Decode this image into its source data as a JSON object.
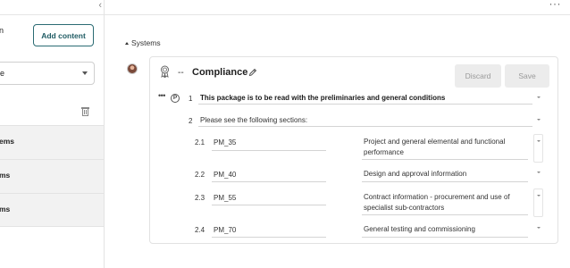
{
  "left_panel": {
    "header_fragment": "n",
    "add_content_label": "Add content",
    "select_value": "e",
    "rows": [
      {
        "label": "ems"
      },
      {
        "label": "ms"
      },
      {
        "label": "ms"
      }
    ]
  },
  "topbar": {
    "collapse_icon": "‹",
    "more_icon": "···"
  },
  "breadcrumb": {
    "section_label": "Systems"
  },
  "clause": {
    "dashes": "--",
    "title": "Compliance",
    "discard_label": "Discard",
    "save_label": "Save",
    "icons": {
      "award": "ribbon-award-icon",
      "edit": "pencil-icon",
      "more": "ellipsis-icon",
      "p": "P"
    },
    "lines": [
      {
        "num": "1",
        "text": "This package is to be read with the preliminaries and general conditions"
      },
      {
        "num": "2",
        "text": "Please see the following sections:"
      }
    ],
    "sub_items": [
      {
        "num": "2.1",
        "code": "PM_35",
        "desc": "Project and general elemental and functional performance"
      },
      {
        "num": "2.2",
        "code": "PM_40",
        "desc": "Design and approval information"
      },
      {
        "num": "2.3",
        "code": "PM_55",
        "desc": "Contract information - procurement and use of specialist sub-contractors"
      },
      {
        "num": "2.4",
        "code": "PM_70",
        "desc": "General testing and commissioning"
      }
    ]
  },
  "colors": {
    "accent": "#1f5b63",
    "button_disabled_bg": "#ececec",
    "border": "#e2e2e2"
  }
}
